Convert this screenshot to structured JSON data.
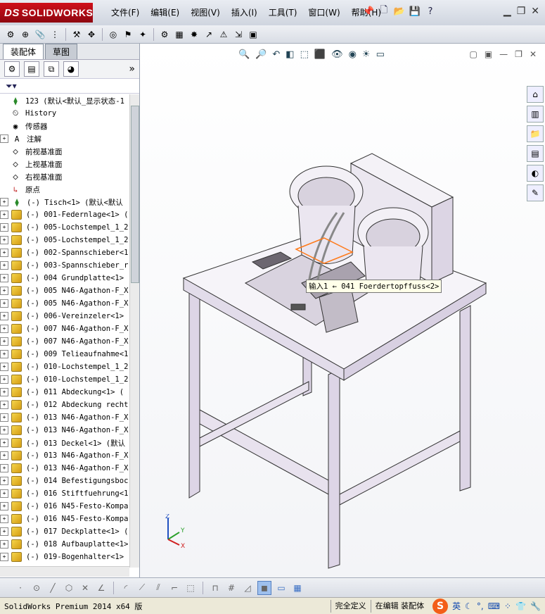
{
  "app": {
    "brand_prefix": "DS",
    "brand": "SOLIDWORKS"
  },
  "menu": [
    "文件(F)",
    "编辑(E)",
    "视图(V)",
    "插入(I)",
    "工具(T)",
    "窗口(W)",
    "帮助(H)"
  ],
  "left_panel": {
    "tabs": [
      "装配体",
      "草图"
    ],
    "expand_label": "»",
    "root": "123  (默认<默认_显示状态-1",
    "tree_items": [
      {
        "label": "History",
        "icon": "history-icon",
        "expander": false
      },
      {
        "label": "传感器",
        "icon": "sensor-icon",
        "expander": false
      },
      {
        "label": "注解",
        "icon": "annotation-icon",
        "expander": true
      },
      {
        "label": "前视基准面",
        "icon": "plane-icon",
        "expander": false
      },
      {
        "label": "上视基准面",
        "icon": "plane-icon",
        "expander": false
      },
      {
        "label": "右视基准面",
        "icon": "plane-icon",
        "expander": false
      },
      {
        "label": "原点",
        "icon": "origin-icon",
        "expander": false
      },
      {
        "label": "(-) Tisch<1> (默认<默认",
        "icon": "assembly-icon",
        "expander": true
      },
      {
        "label": "(-) 001-Federnlage<1> (",
        "icon": "part-icon",
        "expander": true
      },
      {
        "label": "(-) 005-Lochstempel_1_2",
        "icon": "part-icon",
        "expander": true
      },
      {
        "label": "(-) 005-Lochstempel_1_2",
        "icon": "part-icon",
        "expander": true
      },
      {
        "label": "(-) 002-Spannschieber<1",
        "icon": "part-icon",
        "expander": true
      },
      {
        "label": "(-) 003-Spannschieber_r",
        "icon": "part-icon",
        "expander": true
      },
      {
        "label": "(-) 004 Grundplatte<1>",
        "icon": "part-icon",
        "expander": true
      },
      {
        "label": "(-) 005 N46-Agathon-F_X",
        "icon": "part-icon",
        "expander": true
      },
      {
        "label": "(-) 005 N46-Agathon-F_X",
        "icon": "part-icon",
        "expander": true
      },
      {
        "label": "(-) 006-Vereinzeler<1>",
        "icon": "part-icon",
        "expander": true
      },
      {
        "label": "(-) 007 N46-Agathon-F_X",
        "icon": "part-icon",
        "expander": true
      },
      {
        "label": "(-) 007 N46-Agathon-F_X",
        "icon": "part-icon",
        "expander": true
      },
      {
        "label": "(-) 009 Telieaufnahme<1",
        "icon": "part-icon",
        "expander": true
      },
      {
        "label": "(-) 010-Lochstempel_1_2",
        "icon": "part-icon",
        "expander": true
      },
      {
        "label": "(-) 010-Lochstempel_1_2",
        "icon": "part-icon",
        "expander": true
      },
      {
        "label": "(-) 011 Abdeckung<1> (",
        "icon": "part-icon",
        "expander": true
      },
      {
        "label": "(-) 012 Abdeckung recht",
        "icon": "part-icon",
        "expander": true
      },
      {
        "label": "(-) 013 N46-Agathon-F_X",
        "icon": "part-icon",
        "expander": true
      },
      {
        "label": "(-) 013 N46-Agathon-F_X",
        "icon": "part-icon",
        "expander": true
      },
      {
        "label": "(-) 013 Deckel<1> (默认",
        "icon": "part-icon",
        "expander": true
      },
      {
        "label": "(-) 013 N46-Agathon-F_X",
        "icon": "part-icon",
        "expander": true
      },
      {
        "label": "(-) 013 N46-Agathon-F_X",
        "icon": "part-icon",
        "expander": true
      },
      {
        "label": "(-) 014 Befestigungsboc",
        "icon": "part-icon",
        "expander": true
      },
      {
        "label": "(-) 016 Stiftfuehrung<1",
        "icon": "part-icon",
        "expander": true
      },
      {
        "label": "(-) 016 N45-Festo-Kompa",
        "icon": "part-icon",
        "expander": true
      },
      {
        "label": "(-) 016 N45-Festo-Kompa",
        "icon": "part-icon",
        "expander": true
      },
      {
        "label": "(-) 017 Deckplatte<1> (",
        "icon": "part-icon",
        "expander": true
      },
      {
        "label": "(-) 018 Aufbauplatte<1>",
        "icon": "part-icon",
        "expander": true
      },
      {
        "label": "(-) 019-Bogenhalter<1>",
        "icon": "part-icon",
        "expander": true
      }
    ]
  },
  "viewport": {
    "tooltip": "输入1 ← 041 Foerdertopffuss<2>",
    "triad": {
      "x": "X",
      "y": "Y",
      "z": "Z"
    }
  },
  "status": {
    "product": "SolidWorks Premium 2014 x64 版",
    "definition": "完全定义",
    "mode": "在编辑 装配体",
    "ime_logo": "S",
    "ime_lang": "英"
  },
  "colors": {
    "brand_red": "#c8101a",
    "accent_blue": "#3a6fc4",
    "part_yellow": "#e6b425"
  }
}
